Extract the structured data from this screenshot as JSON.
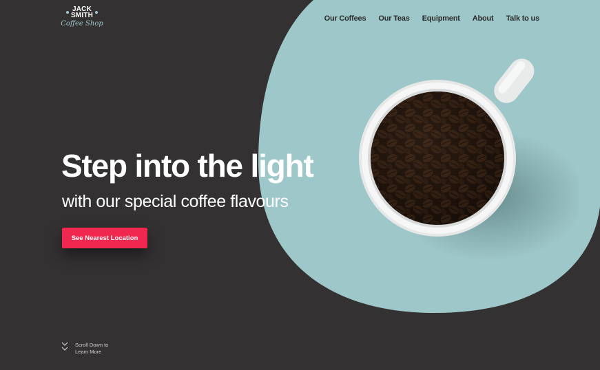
{
  "brand": {
    "name_line1": "JACK",
    "name_line2": "SMITH",
    "tagline": "Coffee Shop"
  },
  "nav": {
    "items": [
      {
        "label": "Our Coffees"
      },
      {
        "label": "Our Teas"
      },
      {
        "label": "Equipment"
      },
      {
        "label": "About"
      },
      {
        "label": "Talk to us"
      }
    ]
  },
  "hero": {
    "headline": "Step into the light",
    "subheadline": "with our special coffee flavours",
    "cta_label": "See Nearest Location"
  },
  "scroll_hint": {
    "line1": "Scroll Down to",
    "line2": "Learn More"
  },
  "colors": {
    "background": "#333132",
    "accent_teal": "#9ec7c9",
    "cta": "#f0274f",
    "text_light": "#ffffff",
    "nav_text": "#2b2a2b"
  },
  "icons": [
    "scroll-chevron-icon",
    "logo-dot-icon"
  ]
}
